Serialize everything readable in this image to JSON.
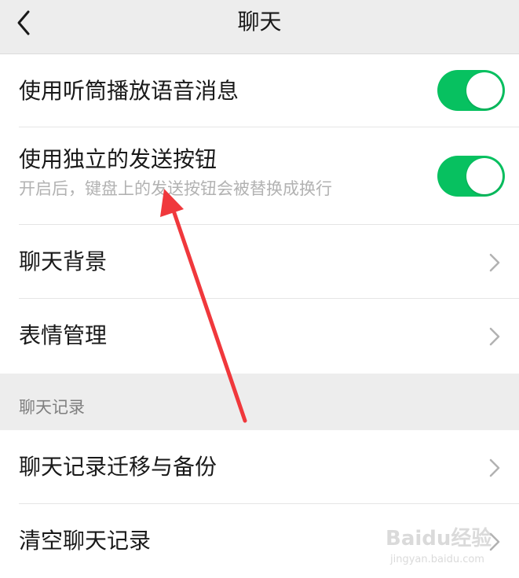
{
  "header": {
    "title": "聊天",
    "back_icon": "chevron-left-icon"
  },
  "settings": {
    "earpiece": {
      "label": "使用听筒播放语音消息",
      "enabled": true
    },
    "send_button": {
      "label": "使用独立的发送按钮",
      "description": "开启后，键盘上的发送按钮会被替换成换行",
      "enabled": true
    },
    "chat_background": {
      "label": "聊天背景"
    },
    "sticker_management": {
      "label": "表情管理"
    }
  },
  "chat_history_section": {
    "header": "聊天记录",
    "items": [
      {
        "label": "聊天记录迁移与备份"
      },
      {
        "label": "清空聊天记录"
      }
    ]
  },
  "colors": {
    "toggle_on": "#07c160",
    "annotation_arrow": "#f0383c",
    "background": "#ededed",
    "row_background": "#ffffff"
  },
  "watermark": {
    "logo_text": "Baidu经验",
    "url": "jingyan.baidu.com"
  }
}
